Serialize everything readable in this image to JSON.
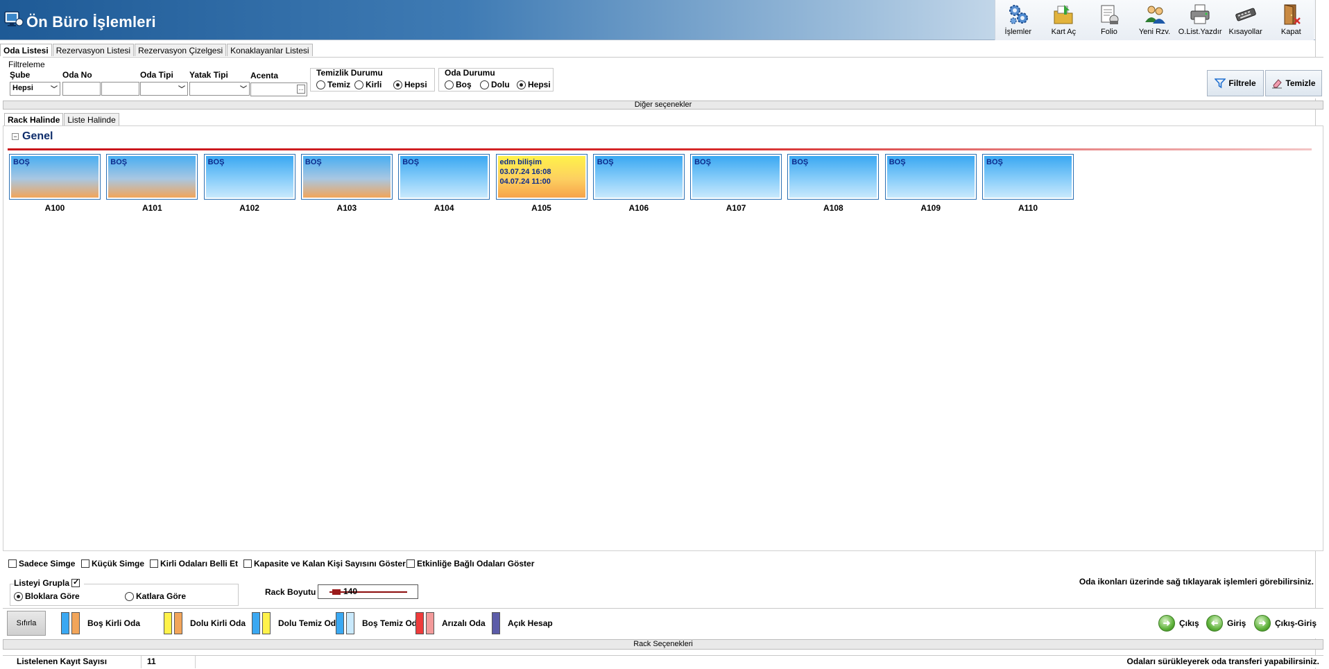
{
  "app": {
    "title": "Ön Büro İşlemleri"
  },
  "toolbar": {
    "items": [
      {
        "label": "İşlemler",
        "icon": "gears-icon"
      },
      {
        "label": "Kart Aç",
        "icon": "card-folder-icon"
      },
      {
        "label": "Folio",
        "icon": "folio-icon"
      },
      {
        "label": "Yeni Rzv.",
        "icon": "new-reservation-icon"
      },
      {
        "label": "O.List.Yazdır",
        "icon": "printer-icon"
      },
      {
        "label": "Kısayollar",
        "icon": "keyboard-icon"
      },
      {
        "label": "Kapat",
        "icon": "exit-door-icon"
      }
    ]
  },
  "main_tabs": [
    "Oda Listesi",
    "Rezervasyon Listesi",
    "Rezervasyon Çizelgesi",
    "Konaklayanlar Listesi"
  ],
  "filter": {
    "group_title": "Filtreleme",
    "sube_label": "Şube",
    "sube_value": "Hepsi",
    "oda_no_label": "Oda No",
    "oda_tipi_label": "Oda Tipi",
    "yatak_tipi_label": "Yatak Tipi",
    "acenta_label": "Acenta",
    "temizlik": {
      "label": "Temizlik Durumu",
      "options": [
        "Temiz",
        "Kirli",
        "Hepsi"
      ],
      "selected": "Hepsi"
    },
    "oda_durumu": {
      "label": "Oda Durumu",
      "options": [
        "Boş",
        "Dolu",
        "Hepsi"
      ],
      "selected": "Hepsi"
    },
    "filter_button": "Filtrele",
    "clear_button": "Temizle"
  },
  "diger_secenekler": "Diğer seçenekler",
  "sub_tabs": [
    "Rack Halinde",
    "Liste Halinde"
  ],
  "rack": {
    "group_name": "Genel",
    "rooms": [
      {
        "no": "A100",
        "status": "kirli",
        "lines": [
          "BOŞ"
        ]
      },
      {
        "no": "A101",
        "status": "kirli",
        "lines": [
          "BOŞ"
        ]
      },
      {
        "no": "A102",
        "status": "temiz",
        "lines": [
          "BOŞ"
        ]
      },
      {
        "no": "A103",
        "status": "kirli",
        "lines": [
          "BOŞ"
        ]
      },
      {
        "no": "A104",
        "status": "temiz",
        "lines": [
          "BOŞ"
        ]
      },
      {
        "no": "A105",
        "status": "dolu",
        "lines": [
          "edm bilişim",
          "03.07.24 16:08",
          "04.07.24 11:00"
        ]
      },
      {
        "no": "A106",
        "status": "temiz",
        "lines": [
          "BOŞ"
        ]
      },
      {
        "no": "A107",
        "status": "temiz",
        "lines": [
          "BOŞ"
        ]
      },
      {
        "no": "A108",
        "status": "temiz",
        "lines": [
          "BOŞ"
        ]
      },
      {
        "no": "A109",
        "status": "temiz",
        "lines": [
          "BOŞ"
        ]
      },
      {
        "no": "A110",
        "status": "temiz",
        "lines": [
          "BOŞ"
        ]
      }
    ]
  },
  "options": {
    "checkboxes": [
      {
        "label": "Sadece Simge",
        "checked": false
      },
      {
        "label": "Küçük Simge",
        "checked": false
      },
      {
        "label": "Kirli Odaları Belli Et",
        "checked": false
      },
      {
        "label": "Kapasite ve Kalan Kişi Sayısını Göster",
        "checked": false
      },
      {
        "label": "Etkinliğe Bağlı Odaları Göster",
        "checked": false
      }
    ],
    "group_list_label": "Listeyi Grupla",
    "group_list_checked": true,
    "group_by": {
      "options": [
        "Bloklara Göre",
        "Katlara Göre"
      ],
      "selected": "Bloklara Göre"
    },
    "rack_size_label": "Rack Boyutu",
    "rack_size_value": "140",
    "hint": "Oda ikonları üzerinde sağ tıklayarak işlemleri görebilirsiniz."
  },
  "legend": {
    "reset_button": "Sıfırla",
    "items": [
      {
        "label": "Boş Kirli Oda",
        "colors": [
          "#3aa8f2",
          "#f2a55a"
        ]
      },
      {
        "label": "Dolu Kirli Oda",
        "colors": [
          "#fff24a",
          "#f2a55a"
        ]
      },
      {
        "label": "Dolu Temiz Oda",
        "colors": [
          "#3aa8f2",
          "#fff24a"
        ]
      },
      {
        "label": "Boş Temiz Oda",
        "colors": [
          "#3aa8f2",
          "#c9e9fc"
        ]
      },
      {
        "label": "Arızalı Oda",
        "colors": [
          "#ee3b3b",
          "#f39a9a"
        ]
      },
      {
        "label": "Açık Hesap",
        "colors": [
          "#5c5ca8"
        ]
      }
    ],
    "actions": [
      "Çıkış",
      "Giriş",
      "Çıkış-Giriş"
    ]
  },
  "rack_secenekleri": "Rack Seçenekleri",
  "status": {
    "count_label": "Listelenen Kayıt Sayısı",
    "count_value": "11",
    "message": "Odaları sürükleyerek oda transferi yapabilirsiniz."
  }
}
